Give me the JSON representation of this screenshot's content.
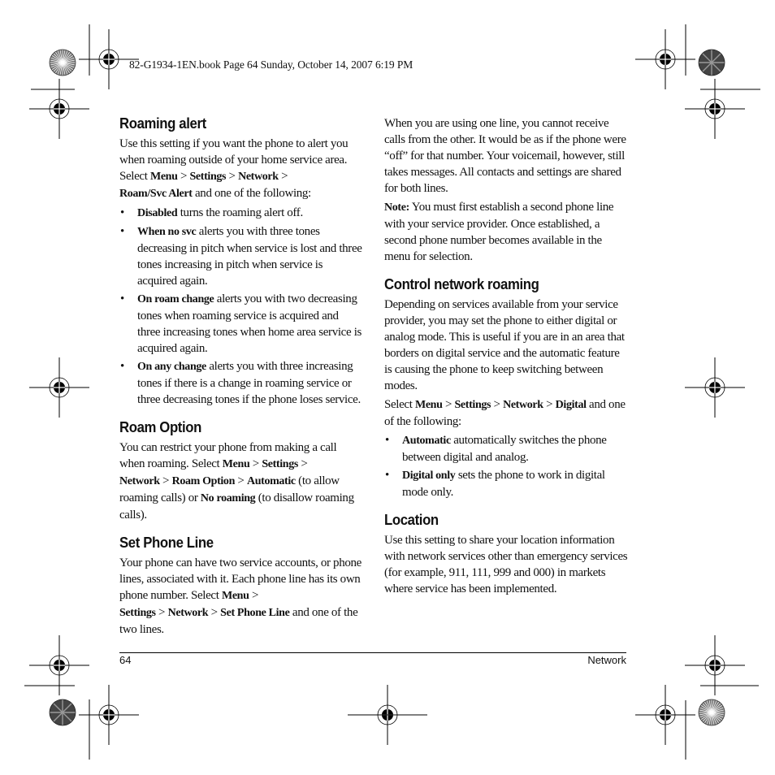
{
  "slug": "82-G1934-1EN.book  Page 64  Sunday, October 14, 2007  6:19 PM",
  "left_column": {
    "roaming_alert": {
      "heading": "Roaming alert",
      "intro": {
        "t1": "Use this setting if you want the phone to alert you when roaming outside of your home service area. Select ",
        "b1": "Menu",
        "t2": " > ",
        "b2": "Settings",
        "t3": " > ",
        "b3": "Network",
        "t4": " > ",
        "b4": "Roam/Svc Alert",
        "t5": " and one of the following:"
      },
      "bullets": [
        {
          "term": "Disabled",
          "text": " turns the roaming alert off."
        },
        {
          "term": "When no svc",
          "text": " alerts you with three tones decreasing in pitch when service is lost and three tones increasing in pitch when service is acquired again."
        },
        {
          "term": "On roam change",
          "text": " alerts you with two decreasing tones when roaming service is acquired and three increasing tones when home area service is acquired again."
        },
        {
          "term": "On any change",
          "text": " alerts you with three increasing tones if there is a change in roaming service or three decreasing tones if the phone loses service."
        }
      ]
    },
    "roam_option": {
      "heading": "Roam Option",
      "body": {
        "t1": "You can restrict your phone from making a call when roaming. Select ",
        "b1": "Menu",
        "t2": " > ",
        "b2": "Settings",
        "t3": " > ",
        "b3": "Network",
        "t4": " > ",
        "b4": "Roam Option",
        "t5": " > ",
        "b5": "Automatic",
        "t6": " (to allow roaming calls) or ",
        "b6": "No roaming",
        "t7": " (to disallow roaming calls)."
      }
    },
    "set_phone_line": {
      "heading": "Set Phone Line",
      "body": {
        "t1": "Your phone can have two service accounts, or phone lines, associated with it. Each phone line has its own phone number. Select ",
        "b1": "Menu",
        "t2": " > ",
        "b2": "Settings",
        "t3": " > ",
        "b3": "Network",
        "t4": " > ",
        "b4": "Set Phone Line",
        "t5": " and one of the two lines."
      }
    }
  },
  "right_column": {
    "phone_line_cont": "When you are using one line, you cannot receive calls from the other. It would be as if the phone were “off” for that number. Your voicemail, however, still takes messages. All contacts and settings are shared for both lines.",
    "note": {
      "label": "Note:",
      "text": " You must first establish a second phone line with your service provider. Once established, a second phone number becomes available in the menu for selection."
    },
    "control_network_roaming": {
      "heading": "Control network roaming",
      "intro": "Depending on services available from your service provider, you may set the phone to either digital or analog mode. This is useful if you are in an area that borders on digital service and the automatic feature is causing the phone to keep switching between modes.",
      "select": {
        "t1": "Select ",
        "b1": "Menu",
        "t2": " > ",
        "b2": "Settings",
        "t3": " > ",
        "b3": "Network",
        "t4": " > ",
        "b4": "Digital",
        "t5": " and one of the following:"
      },
      "bullets": [
        {
          "term": "Automatic",
          "text": " automatically switches the phone between digital and analog."
        },
        {
          "term": "Digital only",
          "text": " sets the phone to work in digital mode only."
        }
      ]
    },
    "location": {
      "heading": "Location",
      "body": "Use this setting to share your location information with network services other than emergency services (for example, 911, 111, 999 and 000) in markets where service has been implemented."
    }
  },
  "footer": {
    "page_number": "64",
    "section": "Network"
  },
  "bullet_glyph": "•"
}
